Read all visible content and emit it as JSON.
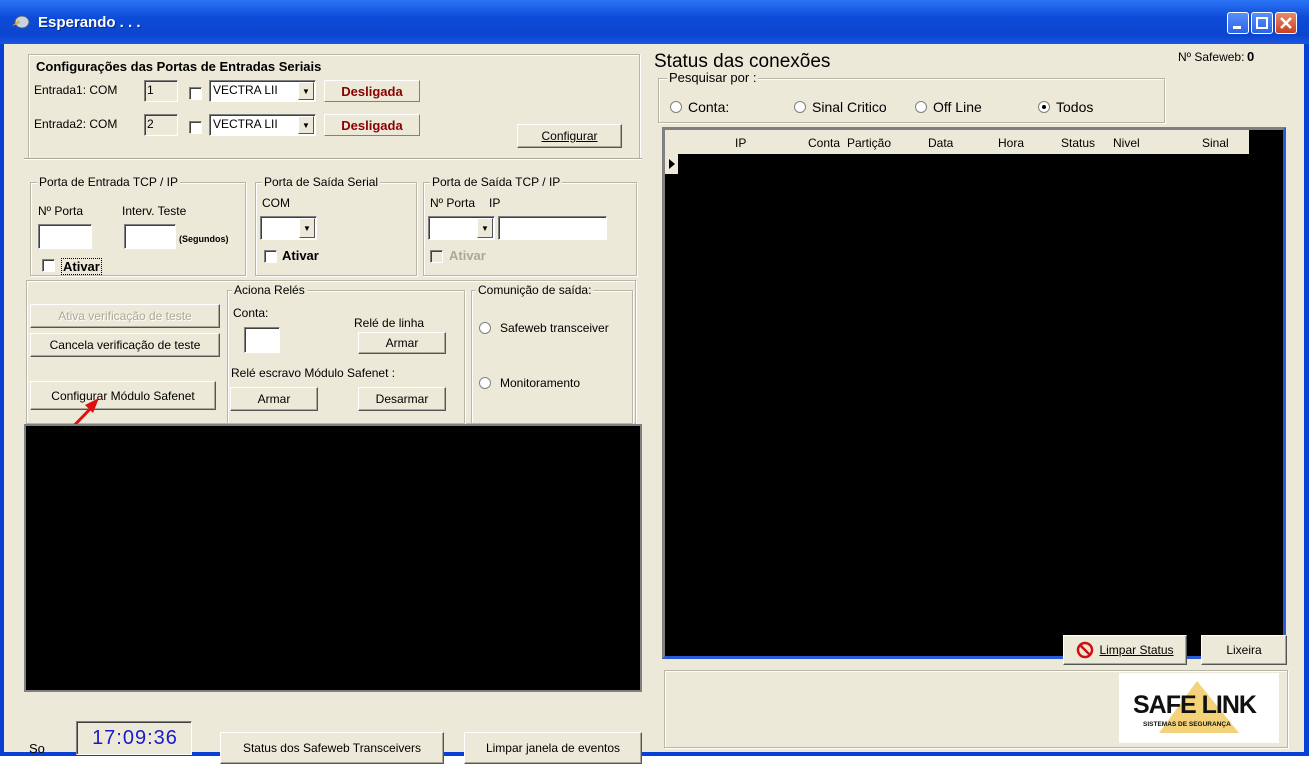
{
  "window": {
    "title": "Esperando . . ."
  },
  "serial_config": {
    "title": "Configurações das Portas de Entradas Seriais",
    "entrada1_label": "Entrada1:  COM",
    "entrada1_com": "1",
    "entrada1_protocol": "VECTRA LII",
    "entrada1_status": "Desligada",
    "entrada2_label": "Entrada2:  COM",
    "entrada2_com": "2",
    "entrada2_protocol": "VECTRA LII",
    "entrada2_status": "Desligada",
    "configure_button": "Configurar"
  },
  "tcp_input": {
    "legend": "Porta de Entrada TCP / IP",
    "port_label": "Nº Porta",
    "interval_label": "Interv. Teste",
    "seconds_label": "(Segundos)",
    "activate_label": "Ativar"
  },
  "serial_output": {
    "legend": "Porta de Saída Serial",
    "com_label": "COM",
    "activate_label": "Ativar"
  },
  "tcp_output": {
    "legend": "Porta de Saída TCP / IP",
    "port_label": "Nº Porta",
    "ip_label": "IP",
    "activate_label": "Ativar"
  },
  "test_buttons": {
    "activate_test": "Ativa verificação de teste",
    "cancel_test": "Cancela verificação de teste",
    "configure_module": "Configurar Módulo Safenet"
  },
  "relays": {
    "legend": "Aciona Relés",
    "account_label": "Conta:",
    "line_relay_label": "Relé de linha",
    "arm_button": "Armar",
    "slave_label": "Relé escravo Módulo Safenet :",
    "slave_arm_button": "Armar",
    "slave_disarm_button": "Desarmar"
  },
  "output_comm": {
    "legend": "Comunição de saída:",
    "option1": "Safeweb transceiver",
    "option2": "Monitoramento"
  },
  "footer": {
    "so_label": "So",
    "clock": "17:09:36",
    "status_button": "Status dos Safeweb Transceivers",
    "clear_events_button": "Limpar janela de eventos"
  },
  "status": {
    "title": "Status das conexões",
    "safeweb_label": "Nº Safeweb:",
    "safeweb_count": "0",
    "search_legend": "Pesquisar por :",
    "filters": [
      "Conta:",
      "Sinal Critico",
      "Off Line",
      "Todos"
    ],
    "selected_filter": "Todos",
    "columns": [
      "IP",
      "Conta",
      "Partição",
      "Data",
      "Hora",
      "Status",
      "Nivel",
      "Sinal"
    ],
    "clear_status_button": "Limpar Status",
    "trash_button": "Lixeira"
  },
  "logo": {
    "brand": "SAFE LINK",
    "tagline": "SISTEMAS DE SEGURANÇA"
  },
  "colors": {
    "clock": "#1a1acc",
    "status_red": "#8b0000",
    "grid_border": "#2a5bd7",
    "titlebar": "#0b45cf"
  }
}
